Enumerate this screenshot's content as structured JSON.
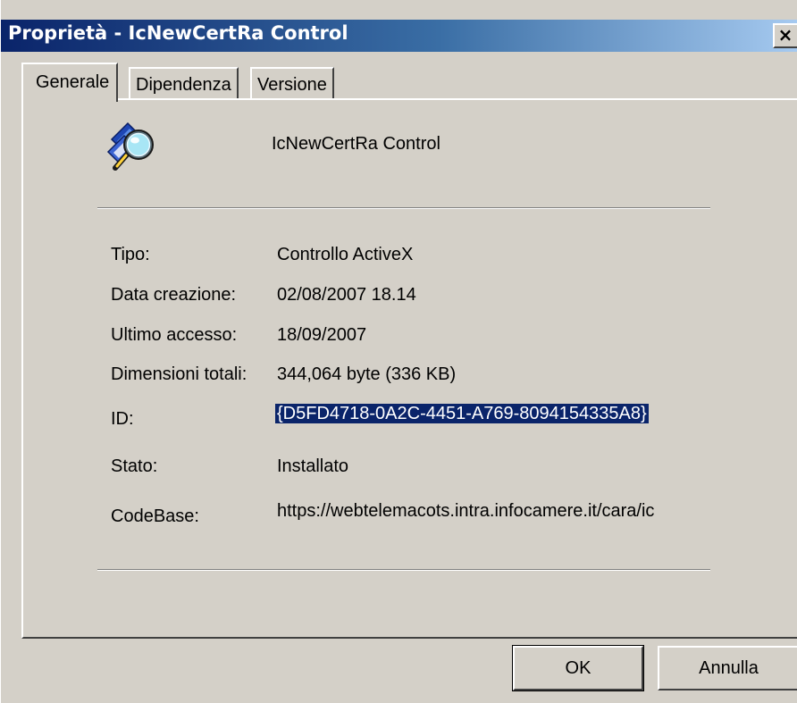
{
  "window": {
    "title": "Proprietà - IcNewCertRa Control",
    "close_label": "×"
  },
  "tabs": [
    {
      "label": "Generale",
      "active": true
    },
    {
      "label": "Dipendenza",
      "active": false
    },
    {
      "label": "Versione",
      "active": false
    }
  ],
  "control": {
    "icon": "activex-control-magnifier-icon",
    "name": "IcNewCertRa Control"
  },
  "properties": [
    {
      "label": "Tipo:",
      "value": "Controllo ActiveX"
    },
    {
      "label": "Data creazione:",
      "value": "02/08/2007 18.14"
    },
    {
      "label": "Ultimo accesso:",
      "value": "18/09/2007"
    },
    {
      "label": "Dimensioni totali:",
      "value": "344,064 byte  (336 KB)"
    },
    {
      "label": "ID:",
      "value": "{D5FD4718-0A2C-4451-A769-8094154335A8}"
    },
    {
      "label": "Stato:",
      "value": "Installato"
    },
    {
      "label": "CodeBase:",
      "value": "https://webtelemacots.intra.infocamere.it/cara/ic"
    }
  ],
  "buttons": {
    "ok_label": "OK",
    "cancel_label": "Annulla"
  },
  "colors": {
    "titlebar_start": "#0a246a",
    "titlebar_end": "#a6caf0",
    "face": "#d4d0c8",
    "selection": "#0a246a"
  }
}
